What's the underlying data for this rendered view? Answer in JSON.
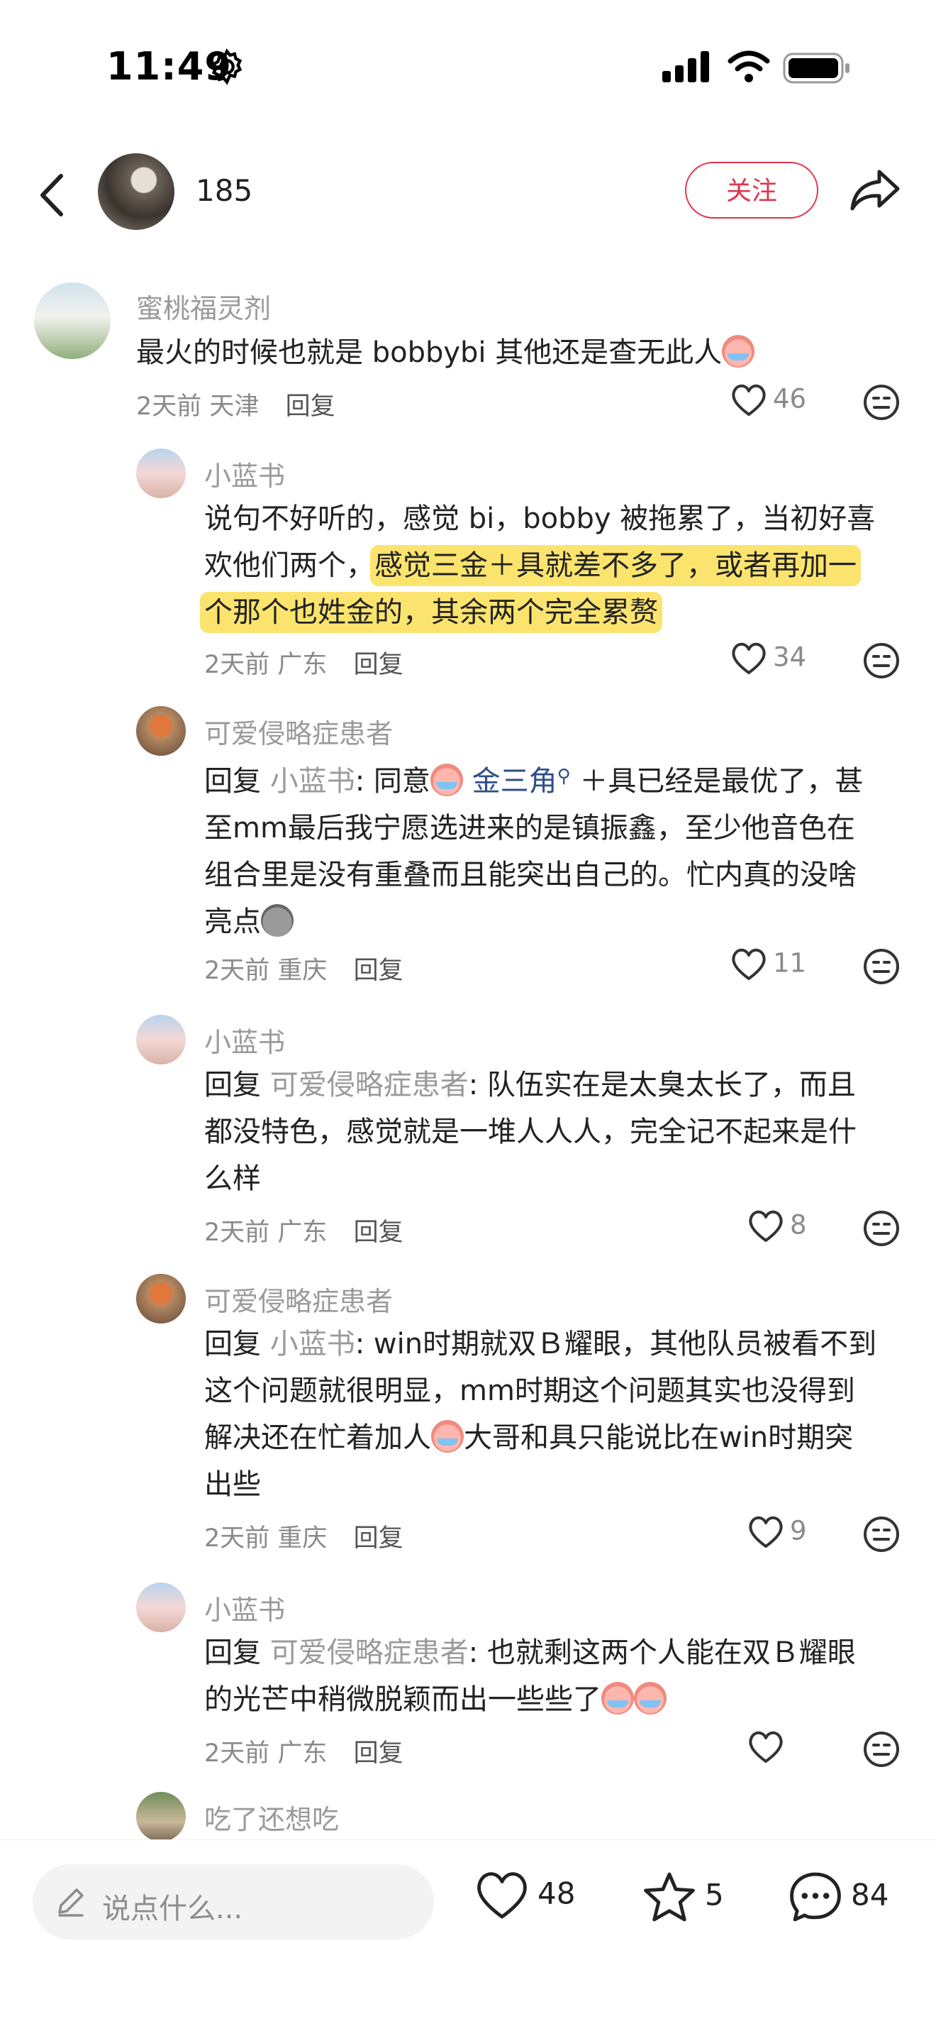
{
  "status_bar": {
    "time": "11:49"
  },
  "header": {
    "author": "185",
    "follow_label": "关注"
  },
  "comments": [
    {
      "user": "蜜桃福灵剂",
      "text": "最火的时候也就是 bobbybi 其他还是查无此人",
      "date": "2天前",
      "location": "天津",
      "reply_label": "回复",
      "likes": "46"
    },
    {
      "user": "小蓝书",
      "line1": "说句不好听的，感觉 bi，bobby 被拖累了，当初好喜",
      "line2a": "欢他们两个，",
      "line2b": "感觉三金＋具就差不多了，或者再加一",
      "line3": "个那个也姓金的，其余两个完全累赘",
      "date": "2天前",
      "location": "广东",
      "reply_label": "回复",
      "likes": "34"
    },
    {
      "user": "可爱侵略症患者",
      "prefix": "回复",
      "ref": "小蓝书",
      "l1a": ": 同意",
      "l1link": " 金三角",
      "l1b": " ＋具已经是最优了，甚",
      "l2": "至mm最后我宁愿选进来的是镇振鑫，至少他音色在",
      "l3": "组合里是没有重叠而且能突出自己的。忙内真的没啥",
      "l4": "亮点",
      "date": "2天前",
      "location": "重庆",
      "reply_label": "回复",
      "likes": "11"
    },
    {
      "user": "小蓝书",
      "prefix": "回复",
      "ref": "可爱侵略症患者",
      "l1": ": 队伍实在是太臭太长了，而且",
      "l2": "都没特色，感觉就是一堆人人人，完全记不起来是什",
      "l3": "么样",
      "date": "2天前",
      "location": "广东",
      "reply_label": "回复",
      "likes": "8"
    },
    {
      "user": "可爱侵略症患者",
      "prefix": "回复",
      "ref": "小蓝书",
      "l1": ": win时期就双Ｂ耀眼，其他队员被看不到",
      "l2": "这个问题就很明显，mm时期这个问题其实也没得到",
      "l3a": "解决还在忙着加人",
      "l3b": "大哥和具只能说比在win时期突",
      "l4": "出些",
      "date": "2天前",
      "location": "重庆",
      "reply_label": "回复",
      "likes": "9"
    },
    {
      "user": "小蓝书",
      "prefix": "回复",
      "ref": "可爱侵略症患者",
      "l1": ": 也就剩这两个人能在双Ｂ耀眼",
      "l2": "的光芒中稍微脱颖而出一些些了",
      "date": "2天前",
      "location": "广东",
      "reply_label": "回复"
    },
    {
      "user": "吃了还想吃"
    }
  ],
  "bottom_bar": {
    "input_placeholder": "说点什么...",
    "likes": "48",
    "stars": "5",
    "comments": "84"
  }
}
